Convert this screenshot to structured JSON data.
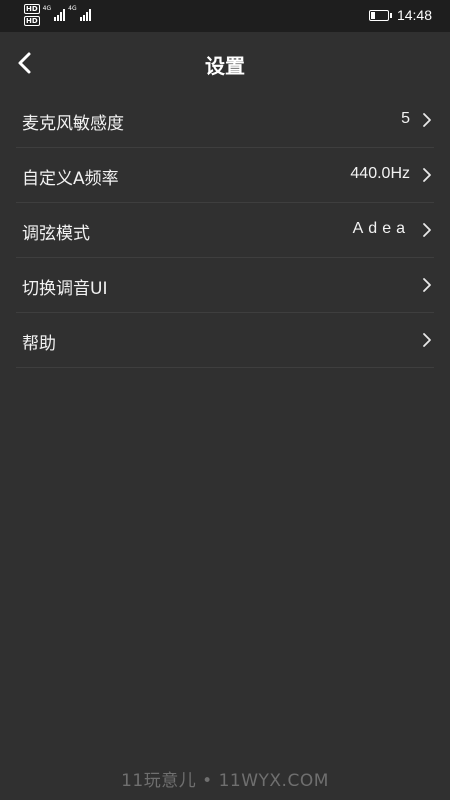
{
  "status_bar": {
    "hd_1": "HD",
    "hd_2": "HD",
    "network_1": "4G",
    "network_2": "4G",
    "time": "14:48",
    "battery_level": 0.25
  },
  "header": {
    "title": "设置",
    "back_icon": "chevron-left-icon"
  },
  "settings": {
    "items": [
      {
        "label": "麦克风敏感度",
        "value": "5"
      },
      {
        "label": "自定义A频率",
        "value": "440.0Hz"
      },
      {
        "label": "调弦模式",
        "value": "Adea"
      },
      {
        "label": "切换调音UI",
        "value": ""
      },
      {
        "label": "帮助",
        "value": ""
      }
    ]
  },
  "watermark": "11玩意儿 • 11WYX.COM",
  "colors": {
    "background": "#303030",
    "status_bar": "#1e1e1e",
    "divider": "#3e3e3e",
    "text": "#f2f2f2",
    "watermark": "#6f6f6f"
  }
}
